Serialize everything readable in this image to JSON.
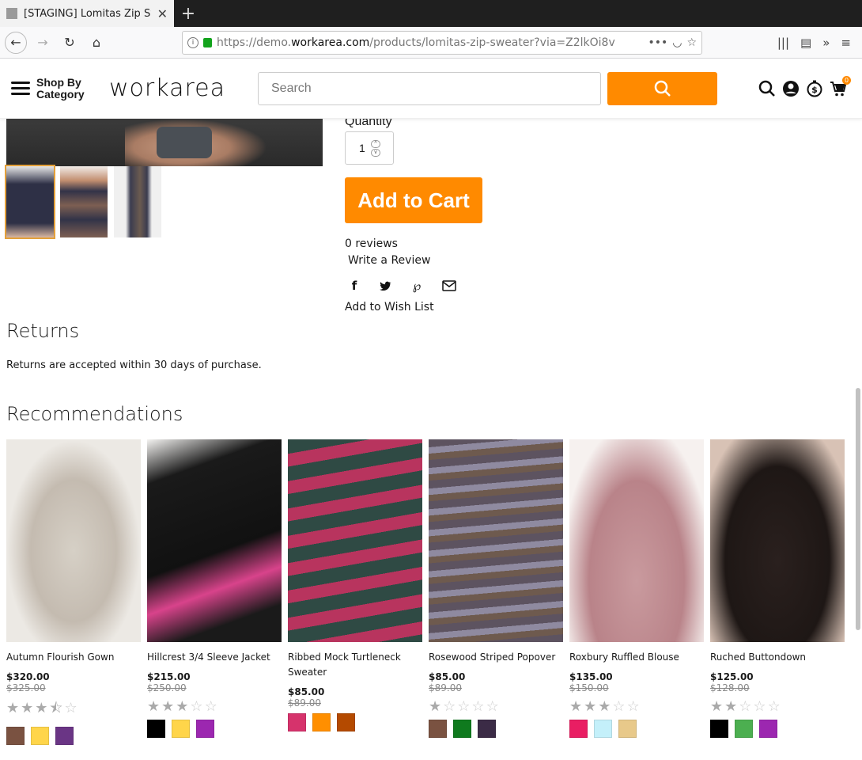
{
  "browser": {
    "tab_title": "[STAGING] Lomitas Zip Sw",
    "url_prefix": "https://demo.",
    "url_domain": "workarea.com",
    "url_rest": "/products/lomitas-zip-sweater?via=Z2lkOi8v",
    "new_tab": "+"
  },
  "header": {
    "shop_by_line1": "Shop By",
    "shop_by_line2": "Category",
    "logo": "workarea",
    "search_placeholder": "Search",
    "cart_count": "0"
  },
  "product": {
    "quantity_label": "Quantity",
    "quantity_value": "1",
    "add_to_cart": "Add to Cart",
    "reviews": "0 reviews",
    "write_review": "Write a Review",
    "add_to_wishlist": "Add to Wish List",
    "share_icons": [
      "facebook-icon",
      "twitter-icon",
      "pinterest-icon",
      "email-icon"
    ]
  },
  "returns": {
    "heading": "Returns",
    "text": "Returns are accepted within 30 days of purchase."
  },
  "recommendations": {
    "heading": "Recommendations",
    "items": [
      {
        "name": "Autumn Flourish Gown",
        "price": "$320.00",
        "was": "$325.00",
        "rating": 3.5,
        "swatches": [
          "#7a5241",
          "#ffd54a",
          "#6a3585"
        ]
      },
      {
        "name": "Hillcrest 3/4 Sleeve Jacket",
        "price": "$215.00",
        "was": "$250.00",
        "rating": 3,
        "swatches": [
          "#000000",
          "#ffd54a",
          "#9c27b0"
        ]
      },
      {
        "name": "Ribbed Mock Turtleneck Sweater",
        "price": "$85.00",
        "was": "$89.00",
        "rating": 0,
        "swatches": [
          "#d6336c",
          "#ff8f00",
          "#b44a00"
        ]
      },
      {
        "name": "Rosewood Striped Popover",
        "price": "$85.00",
        "was": "$89.00",
        "rating": 1,
        "swatches": [
          "#7a5241",
          "#0f7a1e",
          "#3b2b46"
        ]
      },
      {
        "name": "Roxbury Ruffled Blouse",
        "price": "$135.00",
        "was": "$150.00",
        "rating": 3,
        "swatches": [
          "#e91e63",
          "#c4f0fa",
          "#e8c98a"
        ]
      },
      {
        "name": "Ruched Buttondown",
        "price": "$125.00",
        "was": "$128.00",
        "rating": 2,
        "swatches": [
          "#000000",
          "#4caf50",
          "#9c27b0"
        ]
      }
    ]
  },
  "colors": {
    "accent": "#ff8a00"
  }
}
